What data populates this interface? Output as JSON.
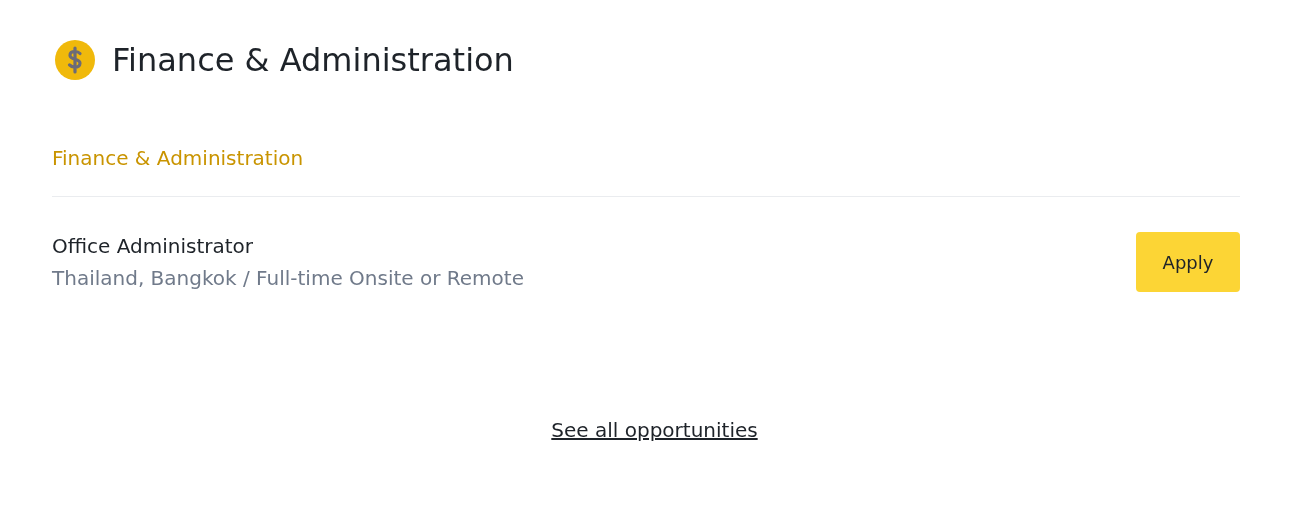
{
  "header": {
    "title": "Finance & Administration"
  },
  "category": {
    "label": "Finance & Administration"
  },
  "jobs": [
    {
      "title": "Office Administrator",
      "location": "Thailand, Bangkok / Full-time Onsite or Remote",
      "button": "Apply"
    }
  ],
  "footer_link": "See all opportunities"
}
